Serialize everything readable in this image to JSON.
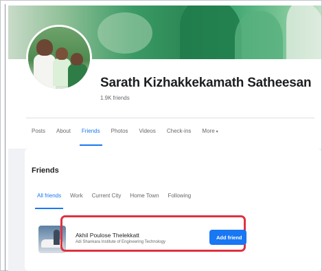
{
  "profile": {
    "name": "Sarath Kizhakkekamath Satheesan",
    "friend_count": "1.9K friends"
  },
  "profile_tabs": [
    {
      "label": "Posts"
    },
    {
      "label": "About"
    },
    {
      "label": "Friends"
    },
    {
      "label": "Photos"
    },
    {
      "label": "Videos"
    },
    {
      "label": "Check-ins"
    },
    {
      "label": "More"
    }
  ],
  "more_caret": "▾",
  "active_profile_tab": "Friends",
  "friends_section": {
    "title": "Friends",
    "subtabs": [
      {
        "label": "All friends"
      },
      {
        "label": "Work"
      },
      {
        "label": "Current City"
      },
      {
        "label": "Home Town"
      },
      {
        "label": "Following"
      }
    ],
    "active_subtab": "All friends"
  },
  "friend_item": {
    "name": "Akhil Poulose Thelekkatt",
    "subtitle": "Adi Shankara Institute of Engineering Technology",
    "button_label": "Add friend"
  },
  "colors": {
    "accent": "#1877f2",
    "highlight": "#e0313f",
    "page_bg": "#f0f2f5"
  }
}
